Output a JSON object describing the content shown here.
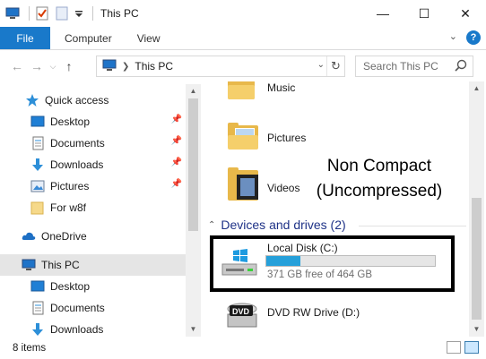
{
  "window": {
    "title": "This PC",
    "controls": {
      "minimize": "—",
      "maximize": "☐",
      "close": "✕"
    }
  },
  "ribbon": {
    "tabs": [
      {
        "label": "File"
      },
      {
        "label": "Computer"
      },
      {
        "label": "View"
      }
    ],
    "expand_glyph": "⌄",
    "help_glyph": "?"
  },
  "address": {
    "path": "This PC",
    "search_placeholder": "Search This PC"
  },
  "nav": {
    "items": [
      {
        "label": "Quick access",
        "icon": "star-icon"
      },
      {
        "label": "Desktop",
        "icon": "desktop-icon",
        "pinned": true
      },
      {
        "label": "Documents",
        "icon": "documents-icon",
        "pinned": true
      },
      {
        "label": "Downloads",
        "icon": "downloads-icon",
        "pinned": true
      },
      {
        "label": "Pictures",
        "icon": "pictures-icon",
        "pinned": true
      },
      {
        "label": "For w8f",
        "icon": "folder-icon"
      },
      {
        "label": "OneDrive",
        "icon": "cloud-icon"
      },
      {
        "label": "This PC",
        "icon": "computer-icon",
        "selected": true
      },
      {
        "label": "Desktop",
        "icon": "desktop-icon"
      },
      {
        "label": "Documents",
        "icon": "documents-icon"
      },
      {
        "label": "Downloads",
        "icon": "downloads-icon"
      }
    ]
  },
  "content": {
    "folders": [
      {
        "label": "Music"
      },
      {
        "label": "Pictures"
      },
      {
        "label": "Videos"
      }
    ],
    "devices_header": "Devices and drives (2)",
    "drives": [
      {
        "label": "Local Disk (C:)",
        "free_text": "371 GB free of 464 GB",
        "used_fraction": 0.2
      },
      {
        "label": "DVD RW Drive (D:)",
        "badge": "DVD"
      }
    ],
    "annotation_lines": [
      "Non Compact",
      "(Uncompressed)"
    ]
  },
  "status": {
    "items_text": "8 items"
  },
  "colors": {
    "accent": "#1979ca",
    "progress": "#26a0da",
    "section": "#1e3287"
  }
}
